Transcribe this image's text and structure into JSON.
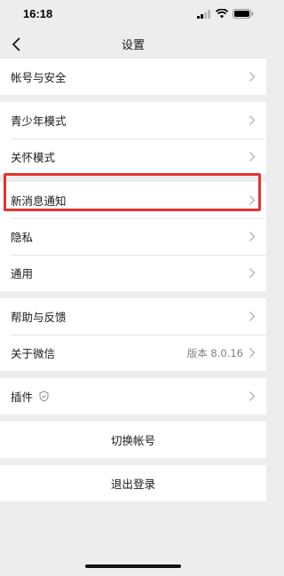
{
  "status_bar": {
    "time": "16:18"
  },
  "nav": {
    "title": "设置"
  },
  "groups": [
    {
      "items": [
        {
          "label": "帐号与安全"
        }
      ]
    },
    {
      "items": [
        {
          "label": "青少年模式"
        },
        {
          "label": "关怀模式"
        }
      ]
    },
    {
      "items": [
        {
          "label": "新消息通知"
        },
        {
          "label": "隐私"
        },
        {
          "label": "通用"
        }
      ]
    },
    {
      "items": [
        {
          "label": "帮助与反馈"
        },
        {
          "label": "关于微信",
          "value": "版本 8.0.16"
        }
      ]
    },
    {
      "items": [
        {
          "label": "插件"
        }
      ]
    }
  ],
  "actions": {
    "switch_account": "切换帐号",
    "logout": "退出登录"
  },
  "highlight": {
    "color": "#e6332e",
    "target": "新消息通知"
  }
}
